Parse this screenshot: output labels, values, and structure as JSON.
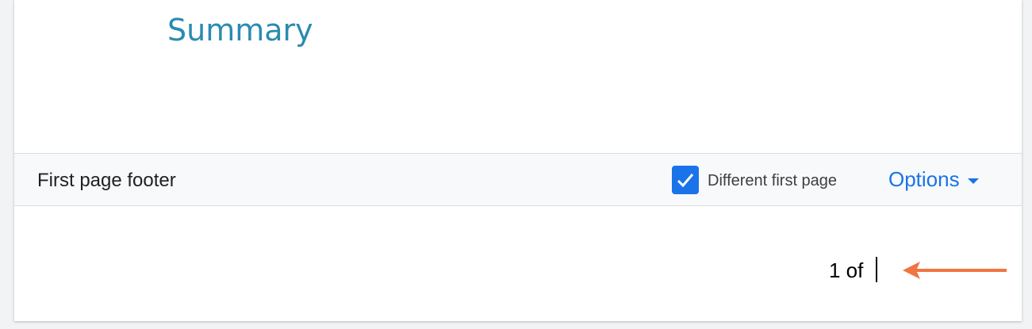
{
  "document": {
    "heading": "Summary"
  },
  "footer": {
    "label": "First page footer",
    "different_first_page": {
      "label": "Different first page",
      "checked": true
    },
    "options_label": "Options",
    "content": "1 of"
  },
  "colors": {
    "accent": "#1a73e8",
    "heading": "#2a8bb0",
    "annotation_arrow": "#f07540"
  }
}
